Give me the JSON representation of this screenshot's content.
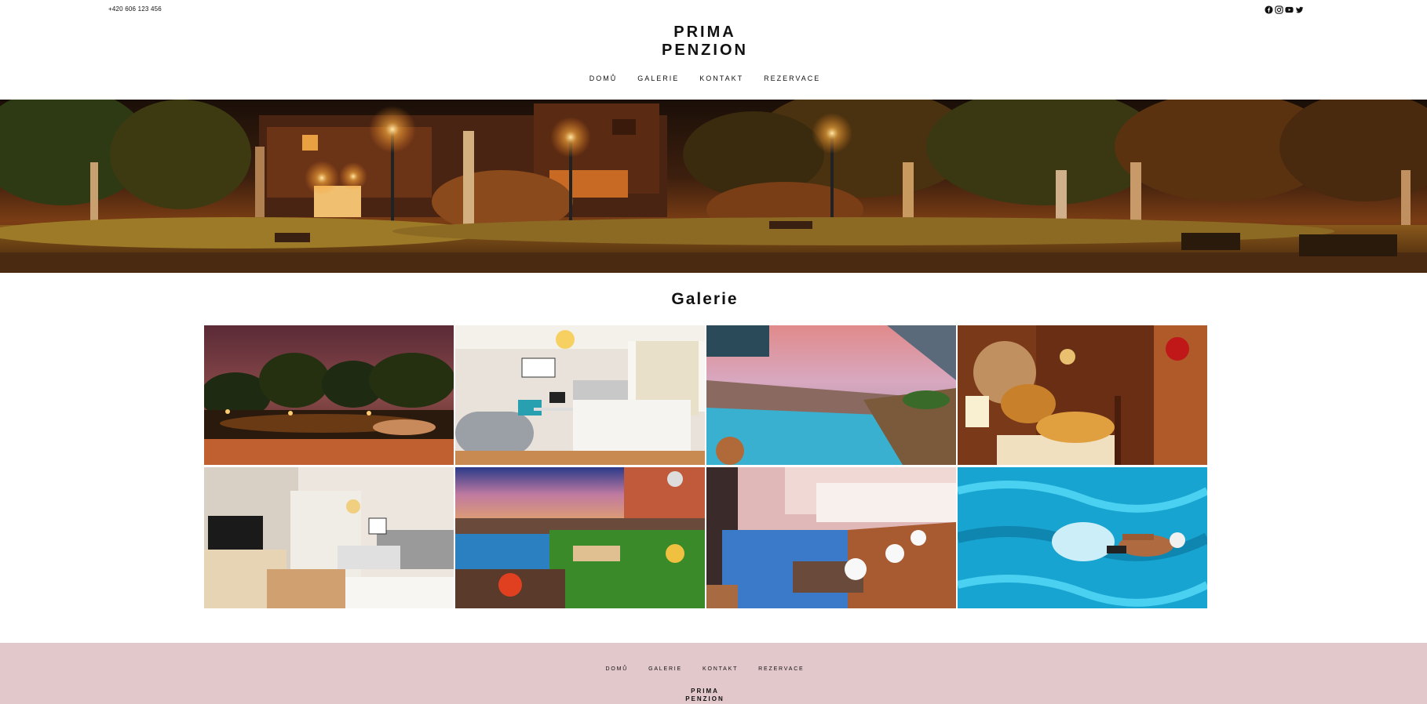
{
  "header": {
    "phone": "+420 606 123 456",
    "brand_line1": "PRIMA",
    "brand_line2": "PENZION",
    "social_icons": [
      "facebook-icon",
      "instagram-icon",
      "youtube-icon",
      "twitter-icon"
    ]
  },
  "nav": {
    "items": [
      {
        "label": "DOMŮ"
      },
      {
        "label": "GALERIE"
      },
      {
        "label": "KONTAKT"
      },
      {
        "label": "REZERVACE"
      }
    ]
  },
  "gallery": {
    "title": "Galerie",
    "tiles": [
      {
        "subject": "park-lake-night"
      },
      {
        "subject": "bedroom-desk"
      },
      {
        "subject": "infinity-pool-sunset"
      },
      {
        "subject": "breakfast-buffet"
      },
      {
        "subject": "room-with-tv"
      },
      {
        "subject": "garden-pool-terrace"
      },
      {
        "subject": "rooftop-pool-dining"
      },
      {
        "subject": "swimmer-pool"
      }
    ]
  },
  "footer": {
    "nav": [
      {
        "label": "DOMŮ"
      },
      {
        "label": "GALERIE"
      },
      {
        "label": "KONTAKT"
      },
      {
        "label": "REZERVACE"
      }
    ],
    "brand_line1": "PRIMA",
    "brand_line2": "PENZION"
  },
  "colors": {
    "footer_bg": "#e2c7cb",
    "text": "#111111"
  }
}
